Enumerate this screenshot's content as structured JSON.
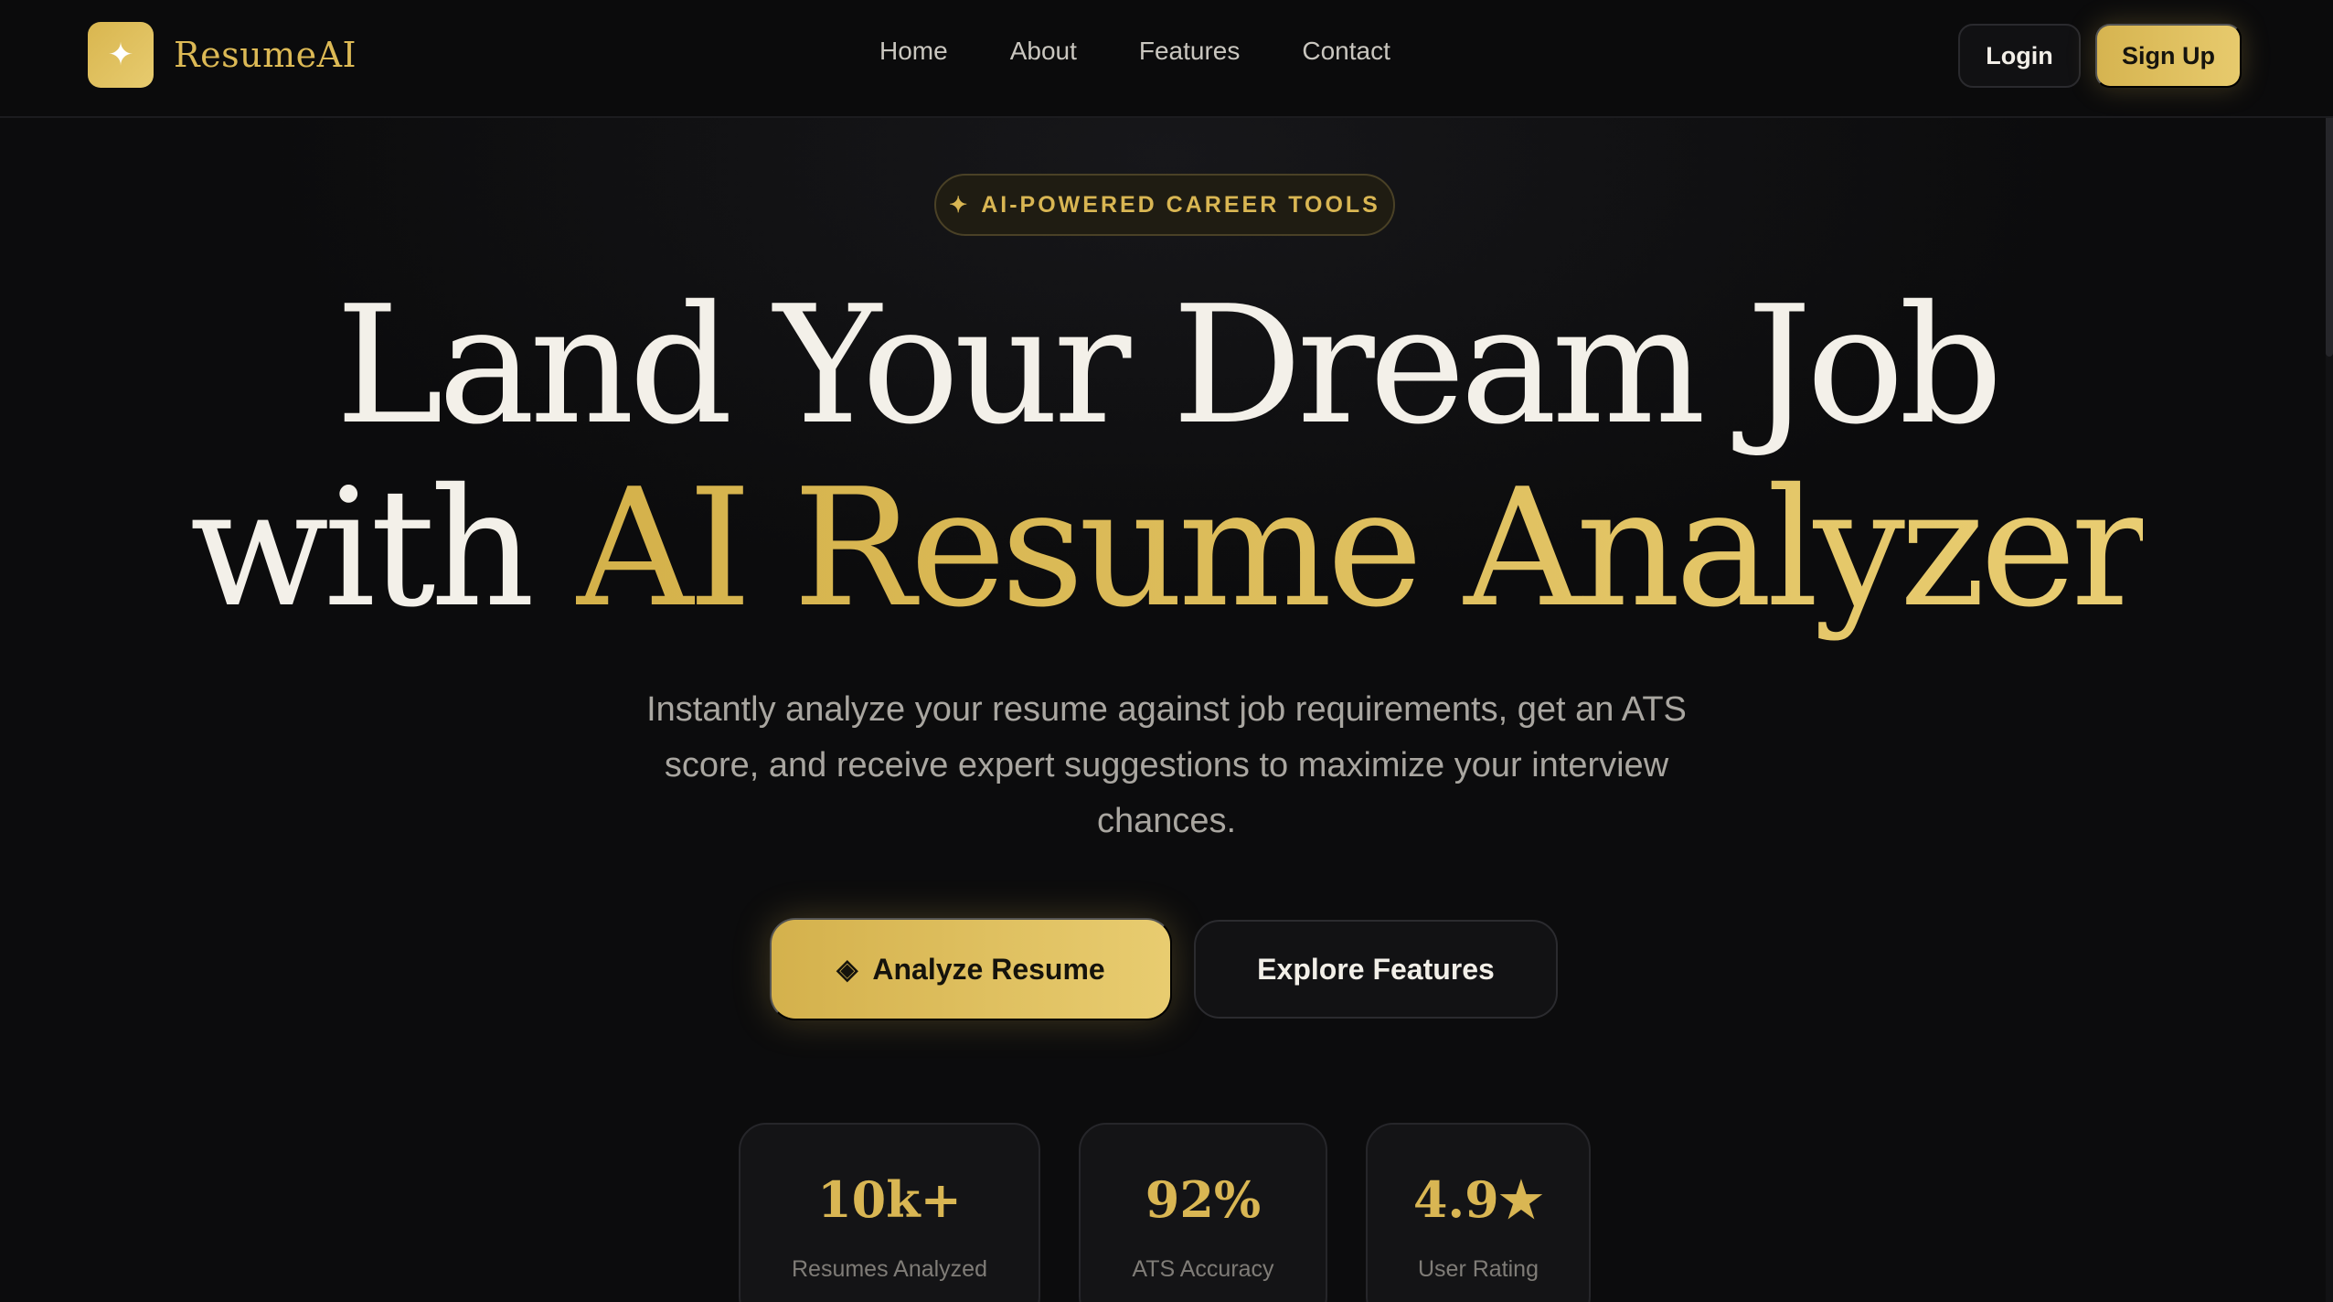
{
  "nav": {
    "brand": "ResumeAI",
    "brand_icon": "sparkle-icon",
    "links": [
      "Home",
      "About",
      "Features",
      "Contact"
    ],
    "login_label": "Login",
    "signup_label": "Sign Up"
  },
  "hero": {
    "tag": "AI-POWERED CAREER TOOLS",
    "headline_line1": "Land Your Dream Job",
    "headline_line2_prefix": "with",
    "headline_line2_highlight": "AI Resume Analyzer",
    "subtitle": "Instantly analyze your resume against job requirements, get an ATS score, and receive expert suggestions to maximize your interview chances.",
    "primary_cta": "Analyze Resume",
    "secondary_cta": "Explore Features"
  },
  "stats": [
    {
      "value": "10k+",
      "label": "Resumes Analyzed"
    },
    {
      "value": "92%",
      "label": "ATS Accuracy"
    },
    {
      "value": "4.9★",
      "label": "User Rating"
    }
  ],
  "colors": {
    "accent": "#dcb955",
    "background": "#0c0c0d",
    "text": "#f2efe8"
  }
}
